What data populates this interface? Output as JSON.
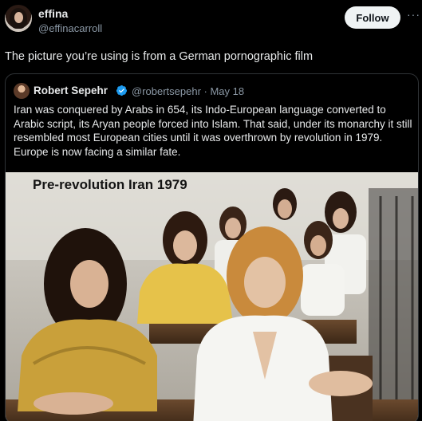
{
  "post": {
    "author_name": "effina",
    "author_handle": "@effinacarroll",
    "follow_label": "Follow",
    "more_icon": "more-options-icon",
    "text": "The picture you’re using is from a German pornographic film"
  },
  "quoted": {
    "author_name": "Robert Sepehr",
    "author_handle": "@robertsepehr · May 18",
    "verified": true,
    "text": "Iran was conquered by Arabs in 654, its Indo-European language converted to Arabic script, its Aryan people forced into Islam. That said, under its monarchy it still resembled most European cities until it was overthrown by revolution in 1979. Europe is now facing a similar fate.",
    "image_caption": "Pre-revolution Iran 1979"
  },
  "colors": {
    "background": "#000000",
    "text": "#e7e9ea",
    "secondary_text": "#8b98a5",
    "verified": "#1d9bf0",
    "follow_button_bg": "#eff3f4"
  }
}
